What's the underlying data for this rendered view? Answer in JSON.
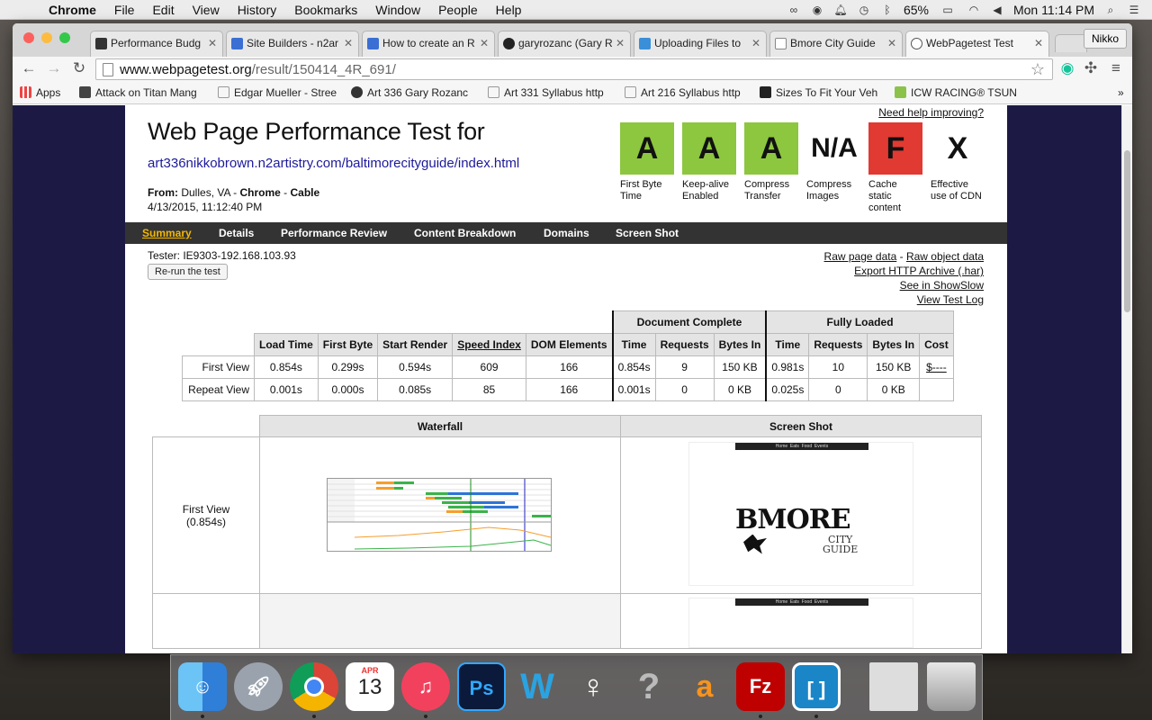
{
  "menubar": {
    "app": "Chrome",
    "items": [
      "File",
      "Edit",
      "View",
      "History",
      "Bookmarks",
      "Window",
      "People",
      "Help"
    ],
    "battery": "65%",
    "clock": "Mon 11:14 PM"
  },
  "browser": {
    "tabs": [
      {
        "label": "Performance Budg",
        "color": "#333333"
      },
      {
        "label": "Site Builders - n2ar",
        "color": "#3b6fd4"
      },
      {
        "label": "How to create an R",
        "color": "#3b6fd4"
      },
      {
        "label": "garyrozanc (Gary R",
        "color": "#222222"
      },
      {
        "label": "Uploading Files to",
        "color": "#3a8fd8"
      },
      {
        "label": "Bmore City Guide",
        "color": "#ffffff"
      },
      {
        "label": "WebPagetest Test",
        "color": "#ffffff"
      }
    ],
    "profile": "Nikko",
    "url_host": "www.webpagetest.org",
    "url_path": "/result/150414_4R_691/",
    "bookmarks": [
      {
        "label": "Apps"
      },
      {
        "label": "Attack on Titan Mang"
      },
      {
        "label": "Edgar Mueller - Stree"
      },
      {
        "label": "Art 336 Gary Rozanc"
      },
      {
        "label": "Art 331 Syllabus http"
      },
      {
        "label": "Art 216 Syllabus http"
      },
      {
        "label": "Sizes To Fit Your Veh"
      },
      {
        "label": "ICW RACING® TSUN"
      }
    ],
    "bookmarks_more": "»"
  },
  "page": {
    "help_link": "Need help improving?",
    "title": "Web Page Performance Test for",
    "tested_url": "art336nikkobrown.n2artistry.com/baltimorecityguide/index.html",
    "from_label": "From:",
    "from_location": "Dulles, VA",
    "from_sep": " - ",
    "from_browser": "Chrome",
    "from_connection": "Cable",
    "date": "4/13/2015, 11:12:40 PM",
    "grades": [
      {
        "grade": "A",
        "label_line1": "First Byte",
        "label_line2": "Time",
        "label_line3": "",
        "color": "#8dc63f"
      },
      {
        "grade": "A",
        "label_line1": "Keep-alive",
        "label_line2": "Enabled",
        "label_line3": "",
        "color": "#8dc63f"
      },
      {
        "grade": "A",
        "label_line1": "Compress",
        "label_line2": "Transfer",
        "label_line3": "",
        "color": "#8dc63f"
      },
      {
        "grade": "N/A",
        "label_line1": "Compress",
        "label_line2": "Images",
        "label_line3": "",
        "color": "#ffffff"
      },
      {
        "grade": "F",
        "label_line1": "Cache",
        "label_line2": "static",
        "label_line3": "content",
        "color": "#e03a32"
      },
      {
        "grade": "X",
        "label_line1": "Effective",
        "label_line2": "use of CDN",
        "label_line3": "",
        "color": "#ffffff"
      }
    ],
    "nav": [
      "Summary",
      "Details",
      "Performance Review",
      "Content Breakdown",
      "Domains",
      "Screen Shot"
    ],
    "tester": "Tester: IE9303-192.168.103.93",
    "rerun": "Re-run the test",
    "links": {
      "raw_page": "Raw page data",
      "sep": " - ",
      "raw_object": "Raw object data",
      "export_har": "Export HTTP Archive (.har)",
      "showslow": "See in ShowSlow",
      "test_log": "View Test Log"
    },
    "results": {
      "group_doc": "Document Complete",
      "group_full": "Fully Loaded",
      "columns": [
        "Load Time",
        "First Byte",
        "Start Render",
        "Speed Index",
        "DOM Elements",
        "Time",
        "Requests",
        "Bytes In",
        "Time",
        "Requests",
        "Bytes In",
        "Cost"
      ],
      "rows": [
        {
          "label": "First View",
          "cells": [
            "0.854s",
            "0.299s",
            "0.594s",
            "609",
            "166",
            "0.854s",
            "9",
            "150 KB",
            "0.981s",
            "10",
            "150 KB",
            "$----"
          ]
        },
        {
          "label": "Repeat View",
          "cells": [
            "0.001s",
            "0.000s",
            "0.085s",
            "85",
            "166",
            "0.001s",
            "0",
            "0 KB",
            "0.025s",
            "0",
            "0 KB",
            ""
          ]
        }
      ]
    },
    "media": {
      "waterfall_header": "Waterfall",
      "screenshot_header": "Screen Shot",
      "first_view_label": "First View",
      "first_view_time": "(0.854s)",
      "ss_menu": [
        "Home",
        "Eats",
        "Food",
        "Events"
      ],
      "ss_logo_line1": "BMORE",
      "ss_logo_line2": "CITY",
      "ss_logo_line3": "GUIDE"
    }
  },
  "dock": {
    "calendar_month": "APR",
    "calendar_day": "13",
    "apps": [
      "finder",
      "launchpad",
      "chrome",
      "calendar",
      "itunes",
      "photoshop",
      "wordpress",
      "aim",
      "help",
      "avast",
      "filezilla",
      "brackets",
      "preview",
      "trash"
    ]
  }
}
